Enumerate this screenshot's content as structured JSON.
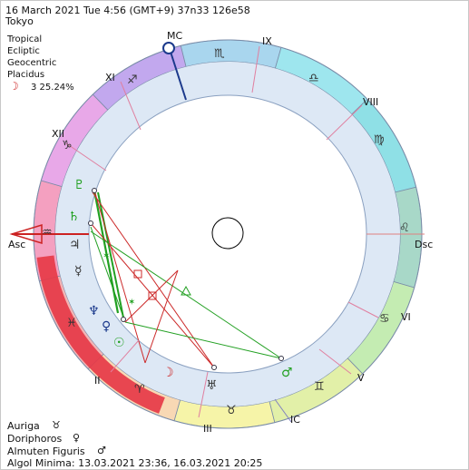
{
  "header": {
    "date_line": "16 March 2021   Tue    4:56  (GMT+9)  37n33   126e58",
    "place": "Tokyo"
  },
  "settings": {
    "zodiac": "Tropical",
    "coordinates": "Ecliptic",
    "center": "Geocentric",
    "houses": "Placidus",
    "moon_glyph": "☽",
    "moon_phase": "3 25.24%"
  },
  "houses": {
    "mc": "MC",
    "ic": "IC",
    "asc": "Asc",
    "dsc": "Dsc",
    "cusps": [
      "II",
      "III",
      "V",
      "VI",
      "VIII",
      "IX",
      "XI",
      "XII"
    ]
  },
  "zodiac_glyphs": {
    "leo": "♌",
    "virgo": "♍",
    "libra": "♎",
    "scorpio": "♏",
    "sagittarius": "♐",
    "capricorn": "♑",
    "aquarius": "♒",
    "pisces": "♓",
    "aries": "♈",
    "taurus": "♉",
    "gemini": "♊",
    "cancer": "♋"
  },
  "planet_glyphs": {
    "pluto": "♇",
    "saturn": "♄",
    "jupiter": "♃",
    "mercury": "☿",
    "neptune": "♆",
    "venus": "♀",
    "sun": "☉",
    "moon": "☽",
    "uranus": "♅",
    "mars": "♂"
  },
  "footer": {
    "lines": [
      {
        "label": "Auriga",
        "glyph": "♉"
      },
      {
        "label": "Doriphoros",
        "glyph": "♀"
      },
      {
        "label": "Almuten Figuris",
        "glyph": "♂"
      }
    ],
    "algol": "Algol Minima: 13.03.2021 23:36,  16.03.2021 20:25"
  },
  "colors": {
    "inner_ring": "#dde8f5",
    "stellium_red": "#e63a48",
    "mc_line": "#1c3a8c",
    "asc_line": "#cc2222",
    "aspect_green": "#22a022",
    "aspect_red": "#cc2a2a"
  }
}
